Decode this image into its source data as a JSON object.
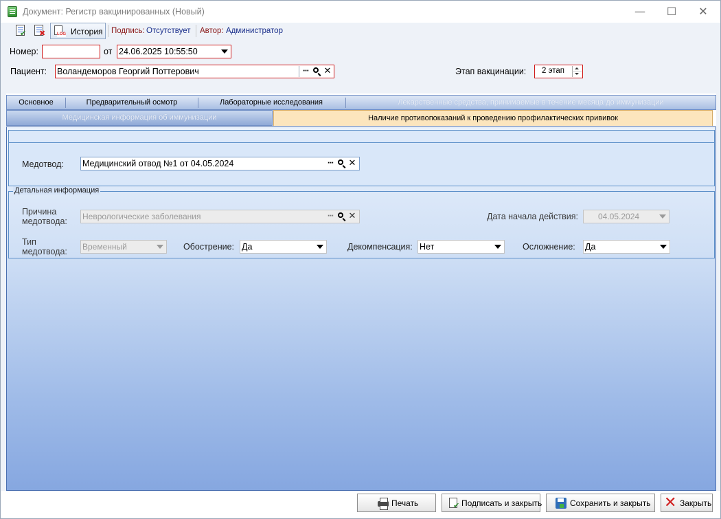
{
  "window": {
    "title": "Документ: Регистр вакцинированных (Новый)",
    "minimize_glyph": "—",
    "maximize_glyph": "☐",
    "close_glyph": "✕"
  },
  "toolbar": {
    "history_label": "История",
    "sign_label": "Подпись:",
    "sign_value": "Отсутствует",
    "author_label": "Автор:",
    "author_value": "Администратор"
  },
  "header": {
    "number_label": "Номер:",
    "number_value": "",
    "from_label": "от",
    "date_value": "24.06.2025 10:55:50",
    "patient_label": "Пациент:",
    "patient_value": "Воландеморов Георгий Поттерович",
    "stage_label": "Этап вакцинации:",
    "stage_value": "2 этап"
  },
  "tabs": {
    "row1": [
      {
        "label": "Основное"
      },
      {
        "label": "Предварительный осмотр"
      },
      {
        "label": "Лабораторные исследования"
      },
      {
        "label": "Лекарственные средства, принимаемые в течение месяца до иммунизации"
      }
    ],
    "row2_left": "Медицинская информация об иммунизации",
    "row2_active": "Наличие противопоказаний к проведению профилактических прививок"
  },
  "main": {
    "medotvod_label": "Медотвод:",
    "medotvod_value": "Медицинский отвод №1 от 04.05.2024",
    "details_title": "Детальная информация",
    "reason_label_1": "Причина",
    "reason_label_2": "медотвода:",
    "reason_value": "Неврологические заболевания",
    "start_date_label": "Дата начала действия:",
    "start_date_value": "04.05.2024",
    "type_label_1": "Тип",
    "type_label_2": "медотвода:",
    "type_value": "Временный",
    "exacerbation_label": "Обострение:",
    "exacerbation_value": "Да",
    "decompensation_label": "Декомпенсация:",
    "decompensation_value": "Нет",
    "complication_label": "Осложнение:",
    "complication_value": "Да"
  },
  "buttons": {
    "print": "Печать",
    "sign_close": "Подписать и закрыть",
    "save_close": "Сохранить и закрыть",
    "close": "Закрыть"
  },
  "icons": {
    "more": "···",
    "clear": "✕"
  },
  "colors": {
    "required_border": "#d01c1c",
    "active_tab": "#fce5bd",
    "panel_gradient_bottom": "#86a7e0"
  }
}
